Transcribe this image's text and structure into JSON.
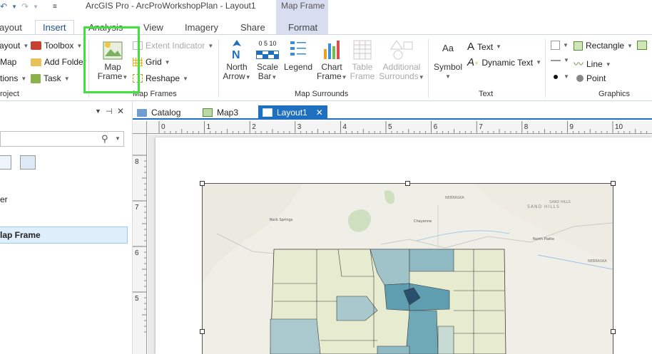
{
  "app": {
    "title": "ArcGIS Pro - ArcProWorkshopPlan - Layout1",
    "context_tab_group": "Map Frame"
  },
  "tabs": [
    {
      "label": "ayout"
    },
    {
      "label": "Insert"
    },
    {
      "label": "Analysis"
    },
    {
      "label": "View"
    },
    {
      "label": "Imagery"
    },
    {
      "label": "Share"
    },
    {
      "label": "Format"
    }
  ],
  "ribbon": {
    "project_group": {
      "label": "roject",
      "items": [
        {
          "label": "ayout"
        },
        {
          "label": "Map"
        },
        {
          "label": "tions"
        }
      ],
      "items2": [
        {
          "label": "Toolbox"
        },
        {
          "label": "Add Folder"
        },
        {
          "label": "Task"
        }
      ]
    },
    "map_frames_group": {
      "label": "Map Frames",
      "map_frame_line1": "Map",
      "map_frame_line2": "Frame",
      "extent_indicator": "Extent Indicator",
      "grid": "Grid",
      "reshape": "Reshape"
    },
    "surrounds_group": {
      "label": "Map Surrounds",
      "north_arrow_1": "North",
      "north_arrow_2": "Arrow",
      "scale_bar_1": "Scale",
      "scale_bar_2": "Bar",
      "scale_bar_ticks": "0 5 10",
      "legend": "Legend",
      "chart_frame_1": "Chart",
      "chart_frame_2": "Frame",
      "table_frame_1": "Table",
      "table_frame_2": "Frame",
      "additional_1": "Additional",
      "additional_2": "Surrounds"
    },
    "text_group": {
      "label": "Text",
      "symbol": "Symbol",
      "text": "Text",
      "dynamic_text": "Dynamic Text",
      "aa": "Aa"
    },
    "graphics_group": {
      "label": "Graphics",
      "rectangle": "Rectangle",
      "line": "Line",
      "point": "Point"
    }
  },
  "left_pane": {
    "item_er": "er",
    "selected": "lap Frame"
  },
  "doc_tabs": [
    {
      "label": "Catalog"
    },
    {
      "label": "Map3"
    },
    {
      "label": "Layout1"
    }
  ],
  "ruler": {
    "h_labels": [
      "0",
      "1",
      "2",
      "3",
      "4",
      "5",
      "6",
      "7",
      "8",
      "9",
      "10"
    ],
    "v_labels": [
      "8",
      "7",
      "6",
      "5"
    ]
  },
  "map_labels": {
    "nebraska": "NEBRASKA",
    "sand_hills_1": "SAND HILLS",
    "sand_hills_2": "SAND HILLS",
    "rock_springs": "Rock Springs",
    "cheyenne": "Cheyenne",
    "north_platte": "North Platte",
    "nebraska2": "NEBRASKA"
  },
  "colors": {
    "accent": "#1f6fc0",
    "highlight": "#3ee23a",
    "ctx": "#d8def0"
  }
}
